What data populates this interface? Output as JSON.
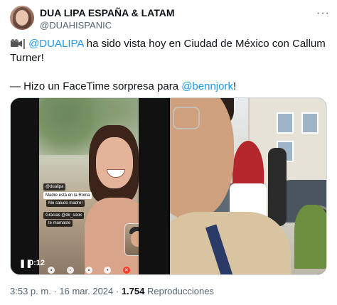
{
  "account": {
    "display_name": "DUA LIPA ESPAÑA & LATAM",
    "handle": "@DUAHISPANIC"
  },
  "tweet": {
    "line1_prefix": "|",
    "mention1": "@DUALIPA",
    "line1_rest": " ha sido vista hoy en Ciudad de México con Callum Turner!",
    "line2_prefix": "— Hizo un FaceTime sorpresa para ",
    "mention2": "@bennjork",
    "line2_suffix": "!"
  },
  "video": {
    "time": "0:12",
    "overlay": {
      "tag": "@dualipa",
      "line1": "Madre está en la Roma",
      "line2": "Me saludo madre!",
      "line3": "Gracias @dir_sook",
      "line4": "te mamaste"
    }
  },
  "footer": {
    "time": "3:53 p. m.",
    "sep1": " · ",
    "date": "16 mar. 2024",
    "sep2": " · ",
    "views": "1.754",
    "views_label": " Reproducciones"
  },
  "icons": {
    "more": "more-horizontal-icon",
    "camera": "video-camera-icon",
    "play": "play-icon"
  },
  "colors": {
    "link": "#1d9bf0",
    "muted": "#536471",
    "text": "#0f1419"
  }
}
